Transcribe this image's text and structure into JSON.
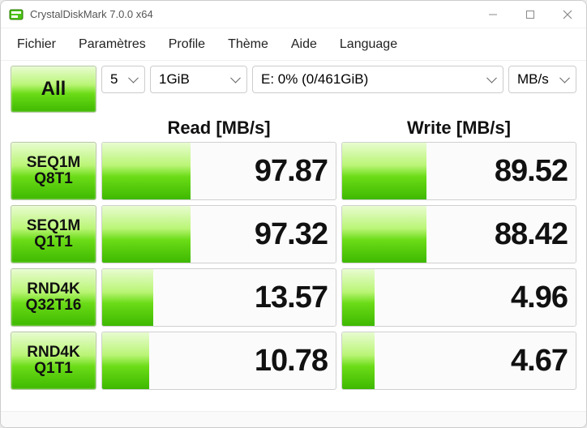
{
  "titlebar": {
    "title": "CrystalDiskMark 7.0.0 x64"
  },
  "menu": {
    "file": "Fichier",
    "settings": "Paramètres",
    "profile": "Profile",
    "theme": "Thème",
    "help": "Aide",
    "language": "Language"
  },
  "controls": {
    "all_label": "All",
    "runs": "5",
    "size": "1GiB",
    "drive": "E: 0% (0/461GiB)",
    "unit": "MB/s"
  },
  "headers": {
    "read": "Read [MB/s]",
    "write": "Write [MB/s]"
  },
  "tests": [
    {
      "label1": "SEQ1M",
      "label2": "Q8T1",
      "read": "97.87",
      "write": "89.52",
      "rbar": 38,
      "wbar": 36
    },
    {
      "label1": "SEQ1M",
      "label2": "Q1T1",
      "read": "97.32",
      "write": "88.42",
      "rbar": 38,
      "wbar": 36
    },
    {
      "label1": "RND4K",
      "label2": "Q32T16",
      "read": "13.57",
      "write": "4.96",
      "rbar": 22,
      "wbar": 14
    },
    {
      "label1": "RND4K",
      "label2": "Q1T1",
      "read": "10.78",
      "write": "4.67",
      "rbar": 20,
      "wbar": 14
    }
  ]
}
